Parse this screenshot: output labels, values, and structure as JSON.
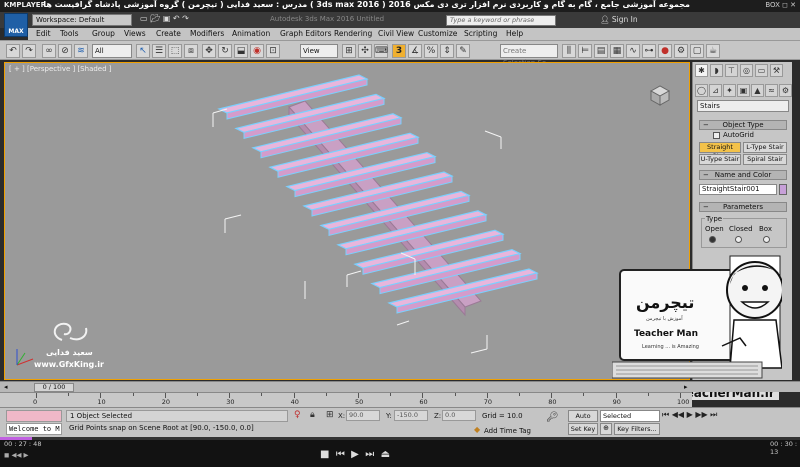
{
  "player": {
    "logo": "KMPLAYER",
    "title": "مجموعه آموزشی جامع ، گام به گام و کاربردی نرم افزار تری دی مکس 2016 ( 3ds max 2016 )  مدرس : سعید فدایی ( تیچرمن ) گروه آموزشی پادشاه گرافیست ها",
    "controls": "BOX ◻ ✕",
    "time_current": "00 : 27 : 48",
    "time_total": "00 : 30 : 13",
    "progress": 0.04,
    "left_info": "◼ ◀◀ ▶"
  },
  "max": {
    "logo": "MAX",
    "workspace": "Workspace: Default",
    "doc_title": "Autodesk 3ds Max 2016    Untitled",
    "search_placeholder": "Type a keyword or phrase",
    "signin": "Sign In"
  },
  "menu": [
    "Edit",
    "Tools",
    "Group",
    "Views",
    "Create",
    "Modifiers",
    "Animation",
    "Graph Editors",
    "Rendering",
    "Civil View",
    "Customize",
    "Scripting",
    "Help"
  ],
  "toolbar": {
    "filter": "All",
    "view": "View",
    "snap": "3",
    "create_selection_set": "Create Selection Se"
  },
  "viewport": {
    "label": "[ + ] [Perspective ] [Shaded ]",
    "stair_color": "#e8b6dc",
    "stair_outline": "#7ad0ff"
  },
  "command_panel": {
    "category": "Stairs",
    "object_type_title": "Object Type",
    "autogrid": "AutoGrid",
    "buttons": [
      "Straight Stair",
      "L-Type Stair",
      "U-Type Stair",
      "Spiral Stair"
    ],
    "name_color_title": "Name and Color",
    "object_name": "StraightStair001",
    "object_color": "#c7a0d8",
    "parameters_title": "Parameters",
    "type_label": "Type",
    "type_options": [
      "Open",
      "Closed",
      "Box"
    ]
  },
  "timeline": {
    "slider_label": "0 / 100",
    "ticks": [
      "0",
      "10",
      "20",
      "30",
      "40",
      "50",
      "60",
      "70",
      "80",
      "90",
      "100"
    ]
  },
  "status": {
    "maxscript": "Welcome to M",
    "selection": "1 Object Selected",
    "prompt": "Grid Points snap on Scene Root at [90.0, -150.0, 0.0]",
    "x_label": "X:",
    "x_value": "90.0",
    "y_label": "Y:",
    "y_value": "-150.0",
    "z_label": "Z:",
    "z_value": "0.0",
    "grid": "Grid = 10.0",
    "add_time_tag": "Add Time Tag",
    "auto_key": "Auto Key",
    "set_key": "Set Key",
    "selected": "Selected",
    "key_filters": "Key Filters..."
  },
  "watermarks": {
    "saeed": "سعید فدایی",
    "gfxking": "www.GfxKing.ir",
    "teacherman_fa": "تیچرمن",
    "teacherman_sub": "آموزش با تیچرمن",
    "teacherman_en": "Teacher Man",
    "learning": "Learning ... is Amazing",
    "url": "www.TeacherMan.ir"
  }
}
